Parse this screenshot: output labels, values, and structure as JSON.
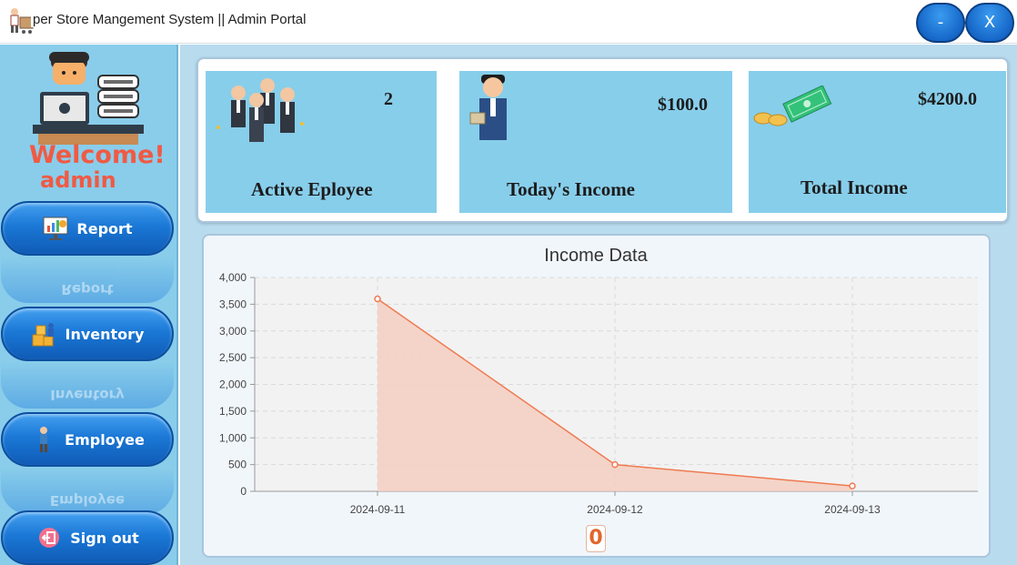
{
  "window": {
    "title": "per Store Mangement System || Admin Portal",
    "minimize_label": "-",
    "close_label": "X"
  },
  "sidebar": {
    "welcome": "Welcome!",
    "username": "admin",
    "nav": [
      {
        "label": "Report",
        "icon": "report-chart-icon"
      },
      {
        "label": "Inventory",
        "icon": "inventory-boxes-icon"
      },
      {
        "label": "Employee",
        "icon": "employee-person-icon"
      },
      {
        "label": "Sign out",
        "icon": "sign-out-icon"
      }
    ]
  },
  "cards": [
    {
      "label": "Active Eployee",
      "value": "2",
      "icon": "employees-group-icon"
    },
    {
      "label": "Today's Income",
      "value": "$100.0",
      "icon": "businessman-money-icon"
    },
    {
      "label": "Total Income",
      "value": "$4200.0",
      "icon": "cash-coins-icon"
    }
  ],
  "chart_badge": "0",
  "chart_data": {
    "type": "area",
    "title": "Income Data",
    "x": [
      "2024-09-11",
      "2024-09-12",
      "2024-09-13"
    ],
    "values": [
      3600,
      500,
      100
    ],
    "ylim": [
      0,
      4000
    ],
    "yticks": [
      "0",
      "500",
      "1,000",
      "1,500",
      "2,000",
      "2,500",
      "3,000",
      "3,500",
      "4,000"
    ],
    "ytick_values": [
      0,
      500,
      1000,
      1500,
      2000,
      2500,
      3000,
      3500,
      4000
    ],
    "grid": true,
    "legend": false,
    "line_color": "#ef7a52",
    "fill_color": "#f4cfc1"
  }
}
